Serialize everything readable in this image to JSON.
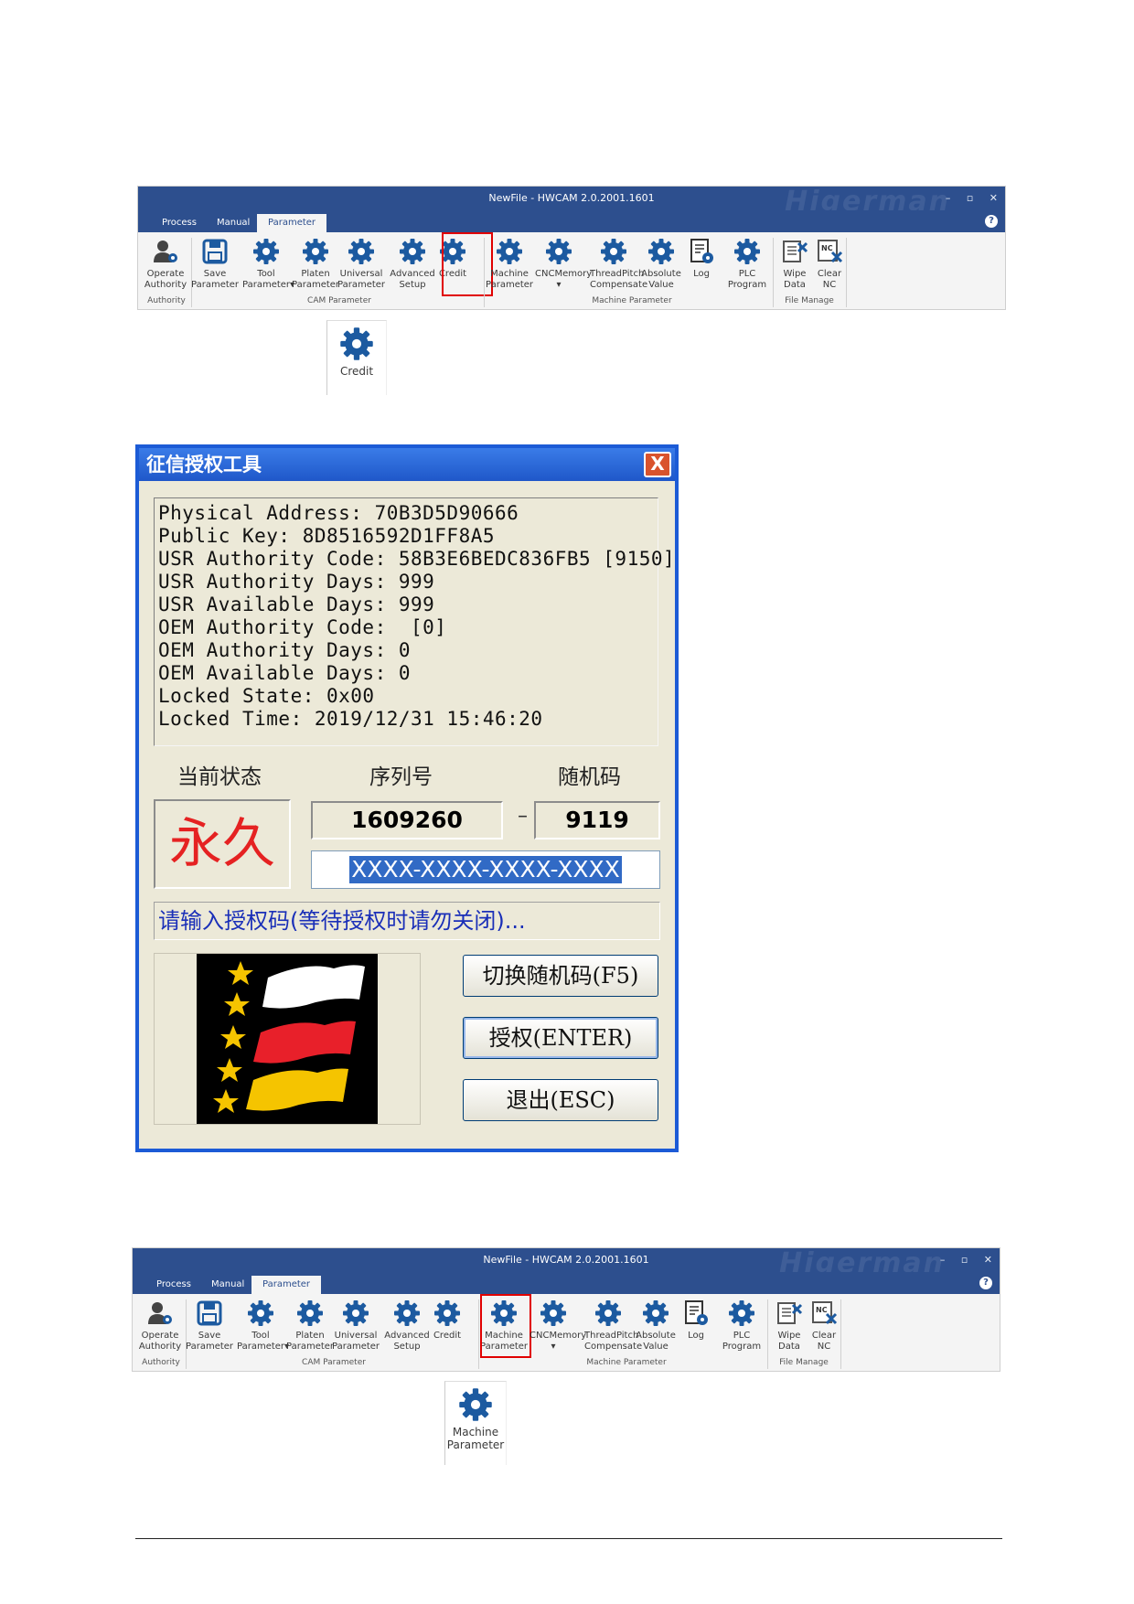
{
  "ribbon": {
    "title": "NewFile - HWCAM 2.0.2001.1601",
    "watermark": "Higerman",
    "window_controls": [
      "–",
      "▫",
      "✕"
    ],
    "help": "?",
    "tabs": [
      {
        "label": "Process"
      },
      {
        "label": "Manual"
      },
      {
        "label": "Parameter"
      }
    ],
    "buttons": [
      {
        "l1": "Operate",
        "l2": "Authority",
        "icon": "user-gear-icon"
      },
      {
        "l1": "Save",
        "l2": "Parameter",
        "icon": "save-icon"
      },
      {
        "l1": "Tool",
        "l2": "Parameter▾",
        "icon": "gear-icon"
      },
      {
        "l1": "Platen",
        "l2": "Parameter",
        "icon": "gear-icon"
      },
      {
        "l1": "Universal",
        "l2": "Parameter",
        "icon": "gear-icon"
      },
      {
        "l1": "Advanced",
        "l2": "Setup",
        "icon": "gear-icon"
      },
      {
        "l1": "Credit",
        "l2": "",
        "icon": "gear-icon"
      },
      {
        "l1": "Machine",
        "l2": "Parameter",
        "icon": "gear-icon"
      },
      {
        "l1": "CNCMemory",
        "l2": "▾",
        "icon": "gear-icon"
      },
      {
        "l1": "ThreadPitch",
        "l2": "Compensate",
        "icon": "gear-icon"
      },
      {
        "l1": "Absolute",
        "l2": "Value",
        "icon": "gear-icon"
      },
      {
        "l1": "Log",
        "l2": "",
        "icon": "log-document-icon"
      },
      {
        "l1": "PLC",
        "l2": "Program",
        "icon": "gear-icon"
      },
      {
        "l1": "Wipe",
        "l2": "Data",
        "icon": "wipe-data-icon"
      },
      {
        "l1": "Clear",
        "l2": "NC",
        "icon": "clear-nc-icon"
      }
    ],
    "groups": [
      "Authority",
      "CAM Parameter",
      "Machine Parameter",
      "File Manage"
    ]
  },
  "zoom1": {
    "label": "Credit"
  },
  "zoom2": {
    "l1": "Machine",
    "l2": "Parameter"
  },
  "dialog": {
    "title": "征信授权工具",
    "close": "X",
    "info_lines": [
      "Physical Address: 70B3D5D90666",
      "Public Key: 8D8516592D1FF8A5",
      "USR Authority Code: 58B3E6BEDC836FB5 [9150]",
      "USR Authority Days: 999",
      "USR Available Days: 999",
      "OEM Authority Code:  [0]",
      "OEM Authority Days: 0",
      "OEM Available Days: 0",
      "Locked State: 0x00",
      "Locked Time: 2019/12/31 15:46:20"
    ],
    "header_status": "当前状态",
    "header_serial": "序列号",
    "header_random": "随机码",
    "status_value": "永久",
    "serial_value": "1609260",
    "dash": "–",
    "random_value": "9119",
    "auth_code_value": "XXXX-XXXX-XXXX-XXXX",
    "message": "请输入授权码(等待授权时请勿关闭)...",
    "btn_switch": "切换随机码(F5)",
    "btn_auth": "授权(ENTER)",
    "btn_exit": "退出(ESC)",
    "logo_colors": {
      "bg": "#000000",
      "star": "#f5c400",
      "white": "#ffffff",
      "red": "#e8202a",
      "yellow": "#f5c400"
    }
  }
}
